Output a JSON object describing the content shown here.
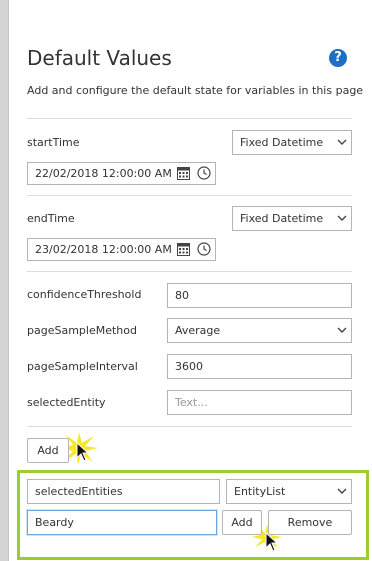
{
  "header": {
    "title": "Default Values",
    "description": "Add and configure the default state for variables in this page",
    "help_icon": "question-icon"
  },
  "variables": {
    "start_time": {
      "label": "startTime",
      "type": "Fixed Datetime",
      "value": "22/02/2018 12:00:00 AM"
    },
    "end_time": {
      "label": "endTime",
      "type": "Fixed Datetime",
      "value": "23/02/2018 12:00:00 AM"
    },
    "confidence_threshold": {
      "label": "confidenceThreshold",
      "value": "80"
    },
    "page_sample_method": {
      "label": "pageSampleMethod",
      "value": "Average"
    },
    "page_sample_interval": {
      "label": "pageSampleInterval",
      "value": "3600"
    },
    "selected_entity": {
      "label": "selectedEntity",
      "placeholder": "Text..."
    }
  },
  "add_button": {
    "label": "Add"
  },
  "new_variable": {
    "name_value": "selectedEntities",
    "type_value": "EntityList",
    "entity_value": "Beardy",
    "add_label": "Add",
    "remove_label": "Remove"
  },
  "colors": {
    "accent_green": "#9acd32",
    "help_blue": "#1e6fc1",
    "highlight_yellow": "#f5e400"
  }
}
